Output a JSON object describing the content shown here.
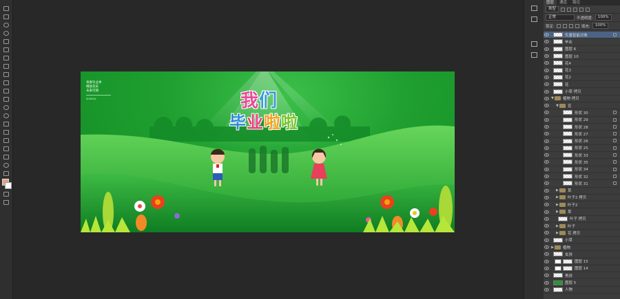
{
  "panel": {
    "tabs": [
      "图层",
      "通道",
      "路径"
    ],
    "kind_filter": "类型",
    "blend_mode": "正常",
    "opacity_label": "不透明度:",
    "opacity_value": "100%",
    "lock_label": "锁定:",
    "fill_label": "填充:",
    "fill_value": "100%"
  },
  "canvas": {
    "small_text": [
      "青春毕业季",
      "细放花朵",
      "未来可期"
    ],
    "tiny_text": "SCHOOL",
    "title_line1": [
      "我",
      "们"
    ],
    "title_line2": [
      "毕",
      "业",
      "啦",
      "啦"
    ]
  },
  "layers": [
    {
      "name": "矢量智能对象",
      "indent": 0,
      "type": "layer",
      "selected": true,
      "lock": true
    },
    {
      "name": "毕业",
      "indent": 0,
      "type": "layer"
    },
    {
      "name": "图层 6",
      "indent": 0,
      "type": "layer"
    },
    {
      "name": "图层 10",
      "indent": 0,
      "type": "layer"
    },
    {
      "name": "花4",
      "indent": 0,
      "type": "layer"
    },
    {
      "name": "花3",
      "indent": 0,
      "type": "layer"
    },
    {
      "name": "花2",
      "indent": 0,
      "type": "layer"
    },
    {
      "name": "花",
      "indent": 0,
      "type": "layer"
    },
    {
      "name": "小草 拷贝",
      "indent": 0,
      "type": "layer"
    },
    {
      "name": "植物 拷贝",
      "indent": 0,
      "type": "group",
      "open": true
    },
    {
      "name": "花",
      "indent": 1,
      "type": "group",
      "open": true
    },
    {
      "name": "形状 30",
      "indent": 2,
      "type": "layer",
      "lock": true
    },
    {
      "name": "形状 29",
      "indent": 2,
      "type": "layer",
      "lock": true
    },
    {
      "name": "形状 28",
      "indent": 2,
      "type": "layer",
      "lock": true
    },
    {
      "name": "形状 27",
      "indent": 2,
      "type": "layer",
      "lock": true
    },
    {
      "name": "形状 26",
      "indent": 2,
      "type": "layer",
      "lock": true
    },
    {
      "name": "形状 25",
      "indent": 2,
      "type": "layer",
      "lock": true
    },
    {
      "name": "形状 33",
      "indent": 2,
      "type": "layer",
      "lock": true
    },
    {
      "name": "形状 35",
      "indent": 2,
      "type": "layer",
      "lock": true
    },
    {
      "name": "形状 34",
      "indent": 2,
      "type": "layer",
      "lock": true
    },
    {
      "name": "形状 32",
      "indent": 2,
      "type": "layer",
      "lock": true
    },
    {
      "name": "形状 31",
      "indent": 2,
      "type": "layer",
      "lock": true
    },
    {
      "name": "草",
      "indent": 1,
      "type": "group"
    },
    {
      "name": "叶子2 拷贝",
      "indent": 1,
      "type": "group"
    },
    {
      "name": "叶子2",
      "indent": 1,
      "type": "group"
    },
    {
      "name": "草",
      "indent": 1,
      "type": "group"
    },
    {
      "name": "叶子 拷贝",
      "indent": 1,
      "type": "layer"
    },
    {
      "name": "叶子",
      "indent": 1,
      "type": "group"
    },
    {
      "name": "花 拷贝",
      "indent": 1,
      "type": "group"
    },
    {
      "name": "小草",
      "indent": 0,
      "type": "layer"
    },
    {
      "name": "植物",
      "indent": 0,
      "type": "group"
    },
    {
      "name": "女孩",
      "indent": 0,
      "type": "layer"
    },
    {
      "name": "图层 15",
      "indent": 0,
      "type": "masked"
    },
    {
      "name": "图层 14",
      "indent": 0,
      "type": "masked"
    },
    {
      "name": "男孩",
      "indent": 0,
      "type": "layer"
    },
    {
      "name": "图层 5",
      "indent": 0,
      "type": "green"
    },
    {
      "name": "人物",
      "indent": 0,
      "type": "layer"
    }
  ]
}
